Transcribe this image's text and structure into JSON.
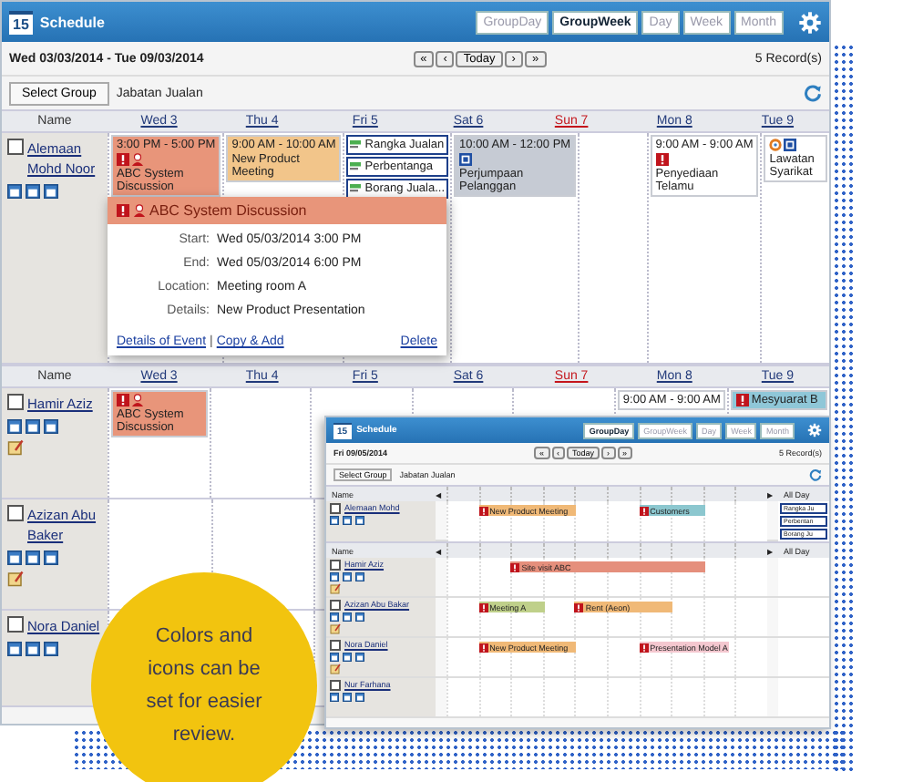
{
  "main_window": {
    "title": "Schedule",
    "app_icon_text": "15",
    "views": [
      {
        "label": "GroupDay",
        "selected": false
      },
      {
        "label": "GroupWeek",
        "selected": true
      },
      {
        "label": "Day",
        "selected": false
      },
      {
        "label": "Week",
        "selected": false
      },
      {
        "label": "Month",
        "selected": false
      }
    ],
    "date_range": "Wed 03/03/2014 - Tue 09/03/2014",
    "nav": [
      "«",
      "‹",
      "Today",
      "›",
      "»"
    ],
    "record_count": "5 Record(s)",
    "select_group_button": "Select Group",
    "group_name": "Jabatan Jualan",
    "blocks": [
      {
        "header": [
          {
            "label": "Name",
            "kind": "name"
          },
          {
            "label": "Wed 3",
            "kind": "day"
          },
          {
            "label": "Thu 4",
            "kind": "day"
          },
          {
            "label": "Fri 5",
            "kind": "day"
          },
          {
            "label": "Sat 6",
            "kind": "day"
          },
          {
            "label": "Sun 7",
            "kind": "sunday"
          },
          {
            "label": "Mon 8",
            "kind": "day"
          },
          {
            "label": "Tue 9",
            "kind": "day"
          }
        ],
        "people": [
          {
            "name": "Alemaan Mohd Noor",
            "checked": false,
            "has_note": false,
            "cells": [
              [
                {
                  "kind": "timed",
                  "time": "3:00 PM - 5:00 PM",
                  "title": "ABC System Discussion",
                  "color": "#e8957a",
                  "priority": true,
                  "info": false,
                  "shared": true,
                  "recurring": false
                }
              ],
              [
                {
                  "kind": "timed",
                  "time": "9:00 AM - 10:00 AM",
                  "title": "New Product Meeting",
                  "color": "#f2c58a",
                  "priority": false,
                  "info": false,
                  "shared": false,
                  "recurring": false
                }
              ],
              [
                {
                  "kind": "task",
                  "title": "Rangka Jualan"
                },
                {
                  "kind": "task",
                  "title": "Perbentanga"
                },
                {
                  "kind": "task",
                  "title": "Borang Juala..."
                }
              ],
              [
                {
                  "kind": "timed",
                  "time": "10:00 AM - 12:00 PM",
                  "title": "Perjumpaan Pelanggan",
                  "color": "#c6cbd4",
                  "priority": false,
                  "info": true,
                  "shared": false,
                  "recurring": false
                }
              ],
              [],
              [
                {
                  "kind": "timed",
                  "time": "9:00 AM - 9:00 AM",
                  "title": "Penyediaan Telamu",
                  "color": "#ffffff",
                  "priority": true,
                  "info": false,
                  "shared": false,
                  "recurring": false
                }
              ],
              [
                {
                  "kind": "timed",
                  "title": "Lawatan Syarikat",
                  "color": "#ffffff",
                  "priority": false,
                  "info": true,
                  "shared": false,
                  "recurring": true
                }
              ]
            ]
          }
        ]
      },
      {
        "header": [
          {
            "label": "Name",
            "kind": "name"
          },
          {
            "label": "Wed 3",
            "kind": "day"
          },
          {
            "label": "Thu 4",
            "kind": "day"
          },
          {
            "label": "Fri 5",
            "kind": "day"
          },
          {
            "label": "Sat 6",
            "kind": "day"
          },
          {
            "label": "Sun 7",
            "kind": "sunday"
          },
          {
            "label": "Mon 8",
            "kind": "day"
          },
          {
            "label": "Tue 9",
            "kind": "day"
          }
        ],
        "people": [
          {
            "name": "Hamir Aziz",
            "checked": false,
            "has_note": true,
            "cells": [
              [
                {
                  "kind": "timed",
                  "title": "ABC System Discussion",
                  "color": "#e8957a",
                  "priority": true,
                  "info": false,
                  "shared": true,
                  "recurring": false
                }
              ],
              [],
              [],
              [],
              [],
              [
                {
                  "kind": "timed",
                  "time": "9:00 AM - 9:00 AM",
                  "color": "#ffffff",
                  "priority": false,
                  "info": false,
                  "shared": false,
                  "recurring": false
                }
              ],
              [
                {
                  "kind": "timed",
                  "title": "Mesyuarat B",
                  "color": "#8fc7d8",
                  "priority": true,
                  "info": false,
                  "shared": false,
                  "recurring": false
                }
              ]
            ]
          },
          {
            "name": "Azizan Abu Baker",
            "checked": false,
            "has_note": true,
            "cells": [
              [],
              [],
              [],
              [],
              [],
              [],
              []
            ]
          },
          {
            "name": "Nora Daniel",
            "checked": false,
            "has_note": false,
            "cells": [
              [],
              [],
              [],
              [],
              [],
              [],
              []
            ]
          }
        ]
      }
    ],
    "popup": {
      "title": "ABC System Discussion",
      "color": "#e8957a",
      "fields": [
        {
          "label": "Start:",
          "value": "Wed 05/03/2014 3:00 PM"
        },
        {
          "label": "End:",
          "value": "Wed 05/03/2014 6:00 PM"
        },
        {
          "label": "Location:",
          "value": "Meeting room A"
        },
        {
          "label": "Details:",
          "value": "New Product Presentation"
        }
      ],
      "links": [
        "Details of Event",
        "Copy & Add"
      ],
      "separator": "|",
      "delete_link": "Delete"
    }
  },
  "second_window": {
    "title": "Schedule",
    "app_icon_text": "15",
    "views": [
      {
        "label": "GroupDay",
        "selected": true
      },
      {
        "label": "GroupWeek",
        "selected": false
      },
      {
        "label": "Day",
        "selected": false
      },
      {
        "label": "Week",
        "selected": false
      },
      {
        "label": "Month",
        "selected": false
      }
    ],
    "date": "Fri 09/05/2014",
    "nav": [
      "«",
      "‹",
      "Today",
      "›",
      "»"
    ],
    "record_count": "5 Record(s)",
    "select_group_button": "Select Group",
    "group_name": "Jabatan Jualan",
    "blocks": [
      {
        "header": {
          "name": "Name",
          "prev": "◀",
          "next": "▶",
          "all_day": "All Day"
        },
        "rows": [
          {
            "name": "Alemaan Mohd",
            "checked": false,
            "has_note": false,
            "timeline": [
              {
                "kind": "empty"
              },
              {
                "kind": "start",
                "title": "New Product Meeting",
                "color": "#f0b977"
              },
              {
                "kind": "continue"
              },
              {
                "kind": "continue"
              },
              {
                "kind": "empty"
              },
              {
                "kind": "empty"
              },
              {
                "kind": "start",
                "title": "Customers",
                "color": "#8cc7cf"
              },
              {
                "kind": "continue"
              },
              {
                "kind": "empty"
              },
              {
                "kind": "empty"
              }
            ],
            "all_day": [
              "Rangka Ju",
              "Perbentan",
              "Borang Ju"
            ]
          }
        ]
      },
      {
        "header": {
          "name": "Name",
          "prev": "◀",
          "next": "▶",
          "all_day": "All Day"
        },
        "rows": [
          {
            "name": "Hamir Aziz",
            "checked": false,
            "has_note": true,
            "timeline": [
              {
                "kind": "empty"
              },
              {
                "kind": "empty"
              },
              {
                "kind": "start",
                "title": "Site visit ABC",
                "color": "#e58f7c"
              },
              {
                "kind": "continue"
              },
              {
                "kind": "continue"
              },
              {
                "kind": "continue"
              },
              {
                "kind": "continue"
              },
              {
                "kind": "continue"
              },
              {
                "kind": "empty"
              },
              {
                "kind": "empty"
              }
            ],
            "all_day": []
          },
          {
            "name": "Azizan Abu Bakar",
            "checked": false,
            "has_note": true,
            "timeline": [
              {
                "kind": "empty"
              },
              {
                "kind": "start",
                "title": "Meeting A",
                "color": "#bfd08a"
              },
              {
                "kind": "continue"
              },
              {
                "kind": "empty"
              },
              {
                "kind": "start",
                "title": "Rent (Aeon)",
                "color": "#f0b977"
              },
              {
                "kind": "continue"
              },
              {
                "kind": "continue"
              },
              {
                "kind": "empty"
              },
              {
                "kind": "empty"
              },
              {
                "kind": "empty"
              }
            ],
            "all_day": []
          },
          {
            "name": "Nora Daniel",
            "checked": false,
            "has_note": true,
            "timeline": [
              {
                "kind": "empty"
              },
              {
                "kind": "start",
                "title": "New Product Meeting",
                "color": "#f0b977"
              },
              {
                "kind": "continue"
              },
              {
                "kind": "continue"
              },
              {
                "kind": "empty"
              },
              {
                "kind": "empty"
              },
              {
                "kind": "start",
                "title": "Presentation Model A",
                "color": "#f4c7cf"
              },
              {
                "kind": "continue"
              },
              {
                "kind": "empty"
              },
              {
                "kind": "empty"
              }
            ],
            "all_day": []
          },
          {
            "name": "Nur Farhana",
            "checked": false,
            "has_note": false,
            "timeline": [
              {
                "kind": "empty"
              },
              {
                "kind": "empty"
              },
              {
                "kind": "empty"
              },
              {
                "kind": "empty"
              },
              {
                "kind": "empty"
              },
              {
                "kind": "empty"
              },
              {
                "kind": "empty"
              },
              {
                "kind": "empty"
              },
              {
                "kind": "empty"
              },
              {
                "kind": "empty"
              }
            ],
            "all_day": []
          }
        ]
      }
    ]
  },
  "callout": {
    "text": "Colors and icons can be set for easier review."
  }
}
